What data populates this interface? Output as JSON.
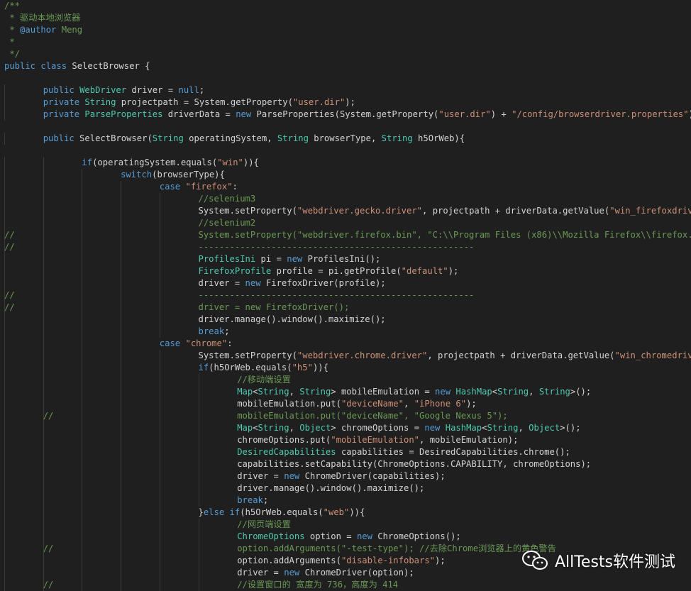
{
  "colors": {
    "background": "#1f1f1f",
    "comment": "#6a9955",
    "keyword": "#569cd6",
    "type": "#4ec9b0",
    "string": "#ce9178",
    "plain": "#d4d4d4"
  },
  "watermark": {
    "icon": "wechat-icon",
    "text": "AllTests软件测试"
  },
  "lines": [
    {
      "prefix": "",
      "tokens": [
        [
          "c",
          "/**"
        ]
      ]
    },
    {
      "prefix": "",
      "tokens": [
        [
          "c",
          " * 驱动本地浏览器"
        ]
      ]
    },
    {
      "prefix": "",
      "tokens": [
        [
          "c",
          " * "
        ],
        [
          "k",
          "@author"
        ],
        [
          "c",
          " Meng"
        ]
      ]
    },
    {
      "prefix": "",
      "tokens": [
        [
          "c",
          " *"
        ]
      ]
    },
    {
      "prefix": "",
      "tokens": [
        [
          "c",
          " */"
        ]
      ]
    },
    {
      "prefix": "",
      "tokens": [
        [
          "k",
          "public"
        ],
        [
          "p",
          " "
        ],
        [
          "k",
          "class"
        ],
        [
          "p",
          " SelectBrowser {"
        ]
      ]
    },
    {
      "prefix": "",
      "tokens": []
    },
    {
      "prefix": "",
      "indent": 1,
      "tokens": [
        [
          "k",
          "public"
        ],
        [
          "p",
          " "
        ],
        [
          "t",
          "WebDriver"
        ],
        [
          "p",
          " driver = "
        ],
        [
          "k",
          "null"
        ],
        [
          "p",
          ";"
        ]
      ]
    },
    {
      "prefix": "",
      "indent": 1,
      "tokens": [
        [
          "k",
          "private"
        ],
        [
          "p",
          " "
        ],
        [
          "t",
          "String"
        ],
        [
          "p",
          " projectpath = System.getProperty("
        ],
        [
          "s",
          "\"user.dir\""
        ],
        [
          "p",
          ");"
        ]
      ]
    },
    {
      "prefix": "",
      "indent": 1,
      "tokens": [
        [
          "k",
          "private"
        ],
        [
          "p",
          " "
        ],
        [
          "t",
          "ParseProperties"
        ],
        [
          "p",
          " driverData = "
        ],
        [
          "k",
          "new"
        ],
        [
          "p",
          " ParseProperties(System.getProperty("
        ],
        [
          "s",
          "\"user.dir\""
        ],
        [
          "p",
          ") + "
        ],
        [
          "s",
          "\"/config/browserdriver.properties\""
        ],
        [
          "p",
          ");"
        ]
      ]
    },
    {
      "prefix": "",
      "tokens": []
    },
    {
      "prefix": "",
      "indent": 1,
      "tokens": [
        [
          "k",
          "public"
        ],
        [
          "p",
          " SelectBrowser("
        ],
        [
          "t",
          "String"
        ],
        [
          "p",
          " operatingSystem, "
        ],
        [
          "t",
          "String"
        ],
        [
          "p",
          " browserType, "
        ],
        [
          "t",
          "String"
        ],
        [
          "p",
          " h5OrWeb){"
        ]
      ]
    },
    {
      "prefix": "",
      "tokens": []
    },
    {
      "prefix": "",
      "indent": 2,
      "tokens": [
        [
          "k",
          "if"
        ],
        [
          "p",
          "(operatingSystem.equals("
        ],
        [
          "s",
          "\"win\""
        ],
        [
          "p",
          ")){"
        ]
      ]
    },
    {
      "prefix": "",
      "indent": 3,
      "tokens": [
        [
          "k",
          "switch"
        ],
        [
          "p",
          "(browserType){"
        ]
      ]
    },
    {
      "prefix": "",
      "indent": 4,
      "tokens": [
        [
          "k",
          "case"
        ],
        [
          "p",
          " "
        ],
        [
          "s",
          "\"firefox\""
        ],
        [
          "p",
          ":"
        ]
      ]
    },
    {
      "prefix": "",
      "indent": 5,
      "tokens": [
        [
          "c",
          "//selenium3"
        ]
      ]
    },
    {
      "prefix": "",
      "indent": 5,
      "tokens": [
        [
          "p",
          "System.setProperty("
        ],
        [
          "s",
          "\"webdriver.gecko.driver\""
        ],
        [
          "p",
          ", projectpath + driverData.getValue("
        ],
        [
          "s",
          "\"win_firefoxdriver\""
        ],
        [
          "p",
          "));"
        ]
      ]
    },
    {
      "prefix": "",
      "indent": 5,
      "tokens": [
        [
          "c",
          "//selenium2"
        ]
      ]
    },
    {
      "prefix": "//",
      "indent": 5,
      "tokens": [
        [
          "c",
          "System.setProperty(\"webdriver.firefox.bin\", \"C:\\\\Program Files (x86)\\\\Mozilla Firefox\\\\firefox.exe\");"
        ]
      ]
    },
    {
      "prefix": "//",
      "indent": 5,
      "tokens": [
        [
          "c",
          "-----------------------------------------------------"
        ]
      ]
    },
    {
      "prefix": "",
      "indent": 5,
      "tokens": [
        [
          "t",
          "ProfilesIni"
        ],
        [
          "p",
          " pi = "
        ],
        [
          "k",
          "new"
        ],
        [
          "p",
          " ProfilesIni();"
        ]
      ]
    },
    {
      "prefix": "",
      "indent": 5,
      "tokens": [
        [
          "t",
          "FirefoxProfile"
        ],
        [
          "p",
          " profile = pi.getProfile("
        ],
        [
          "s",
          "\"default\""
        ],
        [
          "p",
          ");"
        ]
      ]
    },
    {
      "prefix": "",
      "indent": 5,
      "tokens": [
        [
          "p",
          "driver = "
        ],
        [
          "k",
          "new"
        ],
        [
          "p",
          " FirefoxDriver(profile);"
        ]
      ]
    },
    {
      "prefix": "//",
      "indent": 5,
      "tokens": [
        [
          "c",
          "-----------------------------------------------------"
        ]
      ]
    },
    {
      "prefix": "//",
      "indent": 5,
      "tokens": [
        [
          "c",
          "driver = new FirefoxDriver();"
        ]
      ]
    },
    {
      "prefix": "",
      "indent": 5,
      "tokens": [
        [
          "p",
          "driver.manage().window().maximize();"
        ]
      ]
    },
    {
      "prefix": "",
      "indent": 5,
      "tokens": [
        [
          "k",
          "break"
        ],
        [
          "p",
          ";"
        ]
      ]
    },
    {
      "prefix": "",
      "indent": 4,
      "tokens": [
        [
          "k",
          "case"
        ],
        [
          "p",
          " "
        ],
        [
          "s",
          "\"chrome\""
        ],
        [
          "p",
          ":"
        ]
      ]
    },
    {
      "prefix": "",
      "indent": 5,
      "tokens": [
        [
          "p",
          "System.setProperty("
        ],
        [
          "s",
          "\"webdriver.chrome.driver\""
        ],
        [
          "p",
          ", projectpath + driverData.getValue("
        ],
        [
          "s",
          "\"win_chromedriver\""
        ],
        [
          "p",
          "));"
        ]
      ]
    },
    {
      "prefix": "",
      "indent": 5,
      "tokens": [
        [
          "k",
          "if"
        ],
        [
          "p",
          "(h5OrWeb.equals("
        ],
        [
          "s",
          "\"h5\""
        ],
        [
          "p",
          ")){"
        ]
      ]
    },
    {
      "prefix": "",
      "indent": 6,
      "tokens": [
        [
          "c",
          "//移动端设置"
        ]
      ]
    },
    {
      "prefix": "",
      "indent": 6,
      "tokens": [
        [
          "t",
          "Map"
        ],
        [
          "p",
          "<"
        ],
        [
          "t",
          "String"
        ],
        [
          "p",
          ", "
        ],
        [
          "t",
          "String"
        ],
        [
          "p",
          "> mobileEmulation = "
        ],
        [
          "k",
          "new"
        ],
        [
          "p",
          " "
        ],
        [
          "t",
          "HashMap"
        ],
        [
          "p",
          "<"
        ],
        [
          "t",
          "String"
        ],
        [
          "p",
          ", "
        ],
        [
          "t",
          "String"
        ],
        [
          "p",
          ">();"
        ]
      ]
    },
    {
      "prefix": "",
      "indent": 6,
      "tokens": [
        [
          "p",
          "mobileEmulation.put("
        ],
        [
          "s",
          "\"deviceName\""
        ],
        [
          "p",
          ", "
        ],
        [
          "s",
          "\"iPhone 6\""
        ],
        [
          "p",
          ");"
        ]
      ]
    },
    {
      "prefix": "//",
      "indent": 6,
      "tokens": [
        [
          "c",
          "mobileEmulation.put(\"deviceName\", \"Google Nexus 5\");"
        ]
      ]
    },
    {
      "prefix": "",
      "indent": 6,
      "tokens": [
        [
          "t",
          "Map"
        ],
        [
          "p",
          "<"
        ],
        [
          "t",
          "String"
        ],
        [
          "p",
          ", "
        ],
        [
          "t",
          "Object"
        ],
        [
          "p",
          "> chromeOptions = "
        ],
        [
          "k",
          "new"
        ],
        [
          "p",
          " "
        ],
        [
          "t",
          "HashMap"
        ],
        [
          "p",
          "<"
        ],
        [
          "t",
          "String"
        ],
        [
          "p",
          ", "
        ],
        [
          "t",
          "Object"
        ],
        [
          "p",
          ">();"
        ]
      ]
    },
    {
      "prefix": "",
      "indent": 6,
      "tokens": [
        [
          "p",
          "chromeOptions.put("
        ],
        [
          "s",
          "\"mobileEmulation\""
        ],
        [
          "p",
          ", mobileEmulation);"
        ]
      ]
    },
    {
      "prefix": "",
      "indent": 6,
      "tokens": [
        [
          "t",
          "DesiredCapabilities"
        ],
        [
          "p",
          " capabilities = DesiredCapabilities.chrome();"
        ]
      ]
    },
    {
      "prefix": "",
      "indent": 6,
      "tokens": [
        [
          "p",
          "capabilities.setCapability(ChromeOptions.CAPABILITY, chromeOptions);"
        ]
      ]
    },
    {
      "prefix": "",
      "indent": 6,
      "tokens": [
        [
          "p",
          "driver = "
        ],
        [
          "k",
          "new"
        ],
        [
          "p",
          " ChromeDriver(capabilities);"
        ]
      ]
    },
    {
      "prefix": "",
      "indent": 6,
      "tokens": [
        [
          "p",
          "driver.manage().window().maximize();"
        ]
      ]
    },
    {
      "prefix": "",
      "indent": 6,
      "tokens": [
        [
          "k",
          "break"
        ],
        [
          "p",
          ";"
        ]
      ]
    },
    {
      "prefix": "",
      "indent": 5,
      "tokens": [
        [
          "p",
          "}"
        ],
        [
          "k",
          "else"
        ],
        [
          "p",
          " "
        ],
        [
          "k",
          "if"
        ],
        [
          "p",
          "(h5OrWeb.equals("
        ],
        [
          "s",
          "\"web\""
        ],
        [
          "p",
          ")){"
        ]
      ]
    },
    {
      "prefix": "",
      "indent": 6,
      "tokens": [
        [
          "c",
          "//网页端设置"
        ]
      ]
    },
    {
      "prefix": "",
      "indent": 6,
      "tokens": [
        [
          "t",
          "ChromeOptions"
        ],
        [
          "p",
          " option = "
        ],
        [
          "k",
          "new"
        ],
        [
          "p",
          " ChromeOptions();"
        ]
      ]
    },
    {
      "prefix": "//",
      "indent": 6,
      "tokens": [
        [
          "c",
          "option.addArguments(\"-test-type\"); //去除Chrome浏览器上的黄色警告"
        ]
      ]
    },
    {
      "prefix": "",
      "indent": 6,
      "tokens": [
        [
          "p",
          "option.addArguments("
        ],
        [
          "s",
          "\"disable-infobars\""
        ],
        [
          "p",
          ");"
        ]
      ]
    },
    {
      "prefix": "",
      "indent": 6,
      "tokens": [
        [
          "p",
          "driver = "
        ],
        [
          "k",
          "new"
        ],
        [
          "p",
          " ChromeDriver(option);"
        ]
      ]
    },
    {
      "prefix": "//",
      "indent": 6,
      "tokens": [
        [
          "c",
          "//设置窗口的 宽度为 736，高度为 414"
        ]
      ]
    }
  ]
}
